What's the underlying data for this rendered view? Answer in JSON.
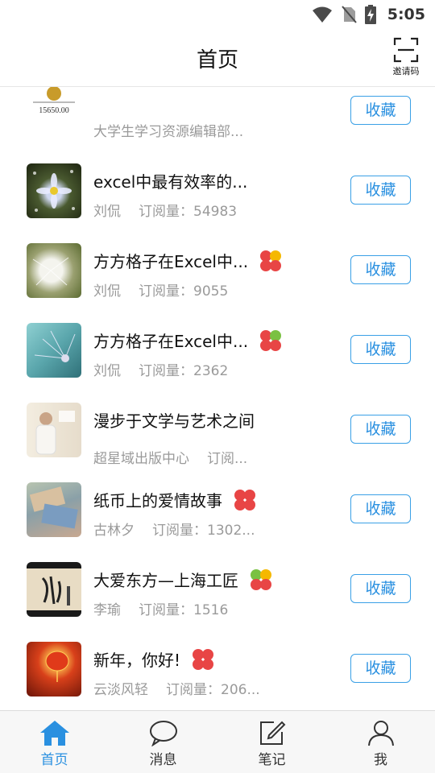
{
  "status_bar": {
    "time": "5:05"
  },
  "header": {
    "title": "首页",
    "invite_label": "邀请码"
  },
  "items": [
    {
      "title": "",
      "author": "大学生学习资源编辑部...",
      "subs": "",
      "thumb_caption": "15650.00",
      "fav": "收藏",
      "clover": false
    },
    {
      "title": "excel中最有效率的...",
      "author": "刘侃",
      "subs": "订阅量：54983",
      "fav": "收藏",
      "clover": false
    },
    {
      "title": "方方格子在Excel中...",
      "author": "刘侃",
      "subs": "订阅量：9055",
      "fav": "收藏",
      "clover": true
    },
    {
      "title": "方方格子在Excel中...",
      "author": "刘侃",
      "subs": "订阅量：2362",
      "fav": "收藏",
      "clover": true
    },
    {
      "title": "漫步于文学与艺术之间",
      "author": "超星域出版中心",
      "subs": "订阅...",
      "fav": "收藏",
      "clover": false
    },
    {
      "title": "纸币上的爱情故事",
      "author": "古林夕",
      "subs": "订阅量：1302...",
      "fav": "收藏",
      "clover": true
    },
    {
      "title": "大爱东方—上海工匠",
      "author": "李瑜",
      "subs": "订阅量：1516",
      "fav": "收藏",
      "clover": true
    },
    {
      "title": "新年，你好!",
      "author": "云淡风轻",
      "subs": "订阅量：206...",
      "fav": "收藏",
      "clover": true
    }
  ],
  "tabs": [
    {
      "label": "首页",
      "icon": "home-icon",
      "active": true
    },
    {
      "label": "消息",
      "icon": "message-icon",
      "active": false
    },
    {
      "label": "笔记",
      "icon": "note-icon",
      "active": false
    },
    {
      "label": "我",
      "icon": "user-icon",
      "active": false
    }
  ],
  "colors": {
    "accent": "#2a90e0",
    "meta_text": "#9a9a9a",
    "clover_red": "#e84545",
    "clover_yellow": "#f5b800",
    "clover_green": "#7ac142"
  }
}
